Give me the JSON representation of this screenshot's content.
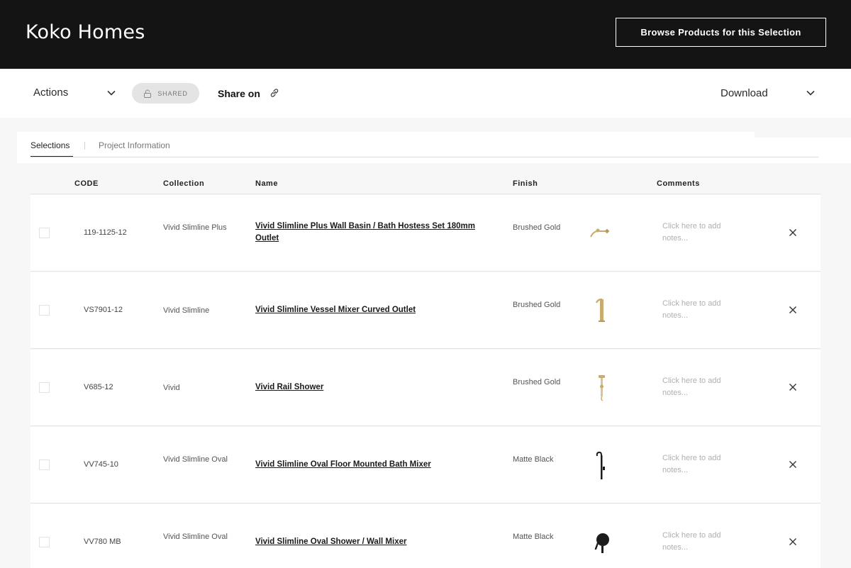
{
  "header": {
    "brand": "Koko Homes",
    "browse_button": "Browse Products for this Selection"
  },
  "toolbar": {
    "actions_label": "Actions",
    "shared_label": "SHARED",
    "share_on_label": "Share on",
    "download_label": "Download"
  },
  "tabs": [
    {
      "label": "Selections",
      "active": true
    },
    {
      "label": "Project Information",
      "active": false
    }
  ],
  "table": {
    "columns": [
      "CODE",
      "Collection",
      "Name",
      "Finish",
      "Comments"
    ],
    "rows": [
      {
        "code": "119-1125-12",
        "collection": "Vivid Slimline Plus",
        "name": "Vivid Slimline Plus Wall Basin / Bath Hostess Set 180mm Outlet",
        "finish": "Brushed Gold",
        "thumb_icon": "wall-basin-set-gold-icon",
        "notes_placeholder": "Click here to add notes..."
      },
      {
        "code": "VS7901-12",
        "collection": "Vivid Slimline",
        "name": "Vivid Slimline Vessel Mixer Curved Outlet",
        "finish": "Brushed Gold",
        "thumb_icon": "vessel-mixer-gold-icon",
        "notes_placeholder": "Click here to add notes..."
      },
      {
        "code": "V685-12",
        "collection": "Vivid",
        "name": "Vivid Rail Shower",
        "finish": "Brushed Gold",
        "thumb_icon": "rail-shower-gold-icon",
        "notes_placeholder": "Click here to add notes..."
      },
      {
        "code": "VV745-10",
        "collection": "Vivid Slimline Oval",
        "name": "Vivid Slimline Oval Floor Mounted Bath Mixer",
        "finish": "Matte Black",
        "thumb_icon": "floor-bath-mixer-black-icon",
        "notes_placeholder": "Click here to add notes..."
      },
      {
        "code": "VV780 MB",
        "collection": "Vivid Slimline Oval",
        "name": "Vivid Slimline Oval Shower / Wall Mixer",
        "finish": "Matte Black",
        "thumb_icon": "wall-mixer-black-icon",
        "notes_placeholder": "Click here to add notes..."
      }
    ]
  },
  "colors": {
    "header_bg": "#141414",
    "gold": "#c9ab6e",
    "black_finish": "#1c1c1c"
  }
}
